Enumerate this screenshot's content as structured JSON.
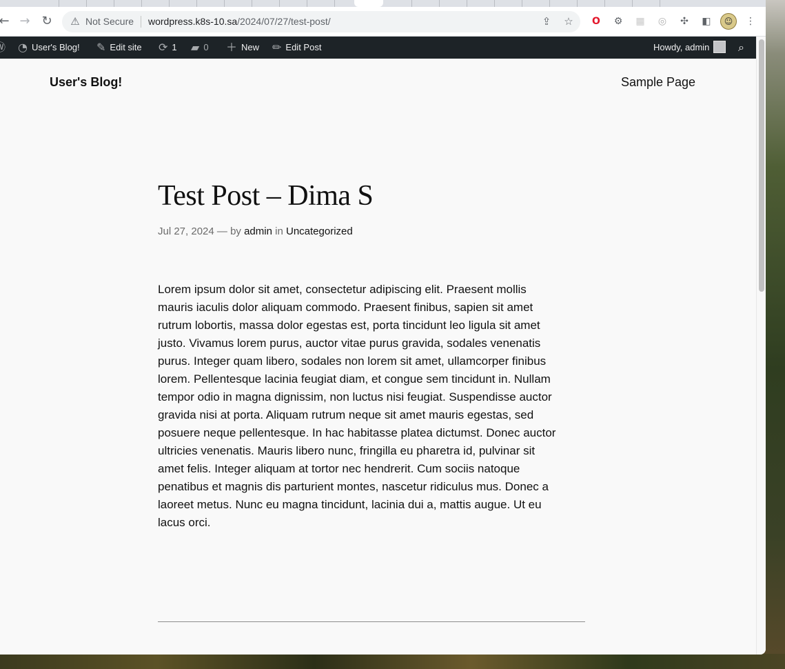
{
  "browser": {
    "security_label": "Not Secure",
    "url_host": "wordpress.k8s-10.sa",
    "url_path": "/2024/07/27/test-post/",
    "icons": {
      "back": "back-arrow-icon",
      "forward": "forward-arrow-icon",
      "reload": "reload-icon",
      "warning": "warning-icon",
      "share": "share-icon",
      "bookmark": "star-icon",
      "extensions": "puzzle-icon",
      "sidepanel": "side-panel-icon",
      "menu": "kebab-menu-icon"
    }
  },
  "adminbar": {
    "site_name": "User's Blog!",
    "edit_site": "Edit site",
    "updates_count": "1",
    "comments_count": "0",
    "new_label": "New",
    "edit_post": "Edit Post",
    "howdy": "Howdy, admin"
  },
  "site": {
    "title": "User's Blog!",
    "nav": [
      "Sample Page"
    ]
  },
  "post": {
    "title": "Test Post – Dima S",
    "date": "Jul 27, 2024",
    "by_sep": "— by",
    "author": "admin",
    "in_label": "in",
    "category": "Uncategorized",
    "body_lines": [
      "Lorem ipsum dolor sit amet, consectetur adipiscing elit. Praesent mollis",
      "mauris iaculis dolor aliquam commodo. Praesent finibus, sapien sit amet",
      "rutrum lobortis, massa dolor egestas est, porta tincidunt leo ligula sit amet",
      "justo. Vivamus lorem purus, auctor vitae purus gravida, sodales venenatis",
      "purus. Integer quam libero, sodales non lorem sit amet, ullamcorper finibus",
      "lorem. Pellentesque lacinia feugiat diam, et congue sem tincidunt in. Nullam",
      "tempor odio in magna dignissim, non luctus nisi feugiat. Suspendisse auctor",
      "gravida nisi at porta. Aliquam rutrum neque sit amet mauris egestas, sed",
      "posuere neque pellentesque. In hac habitasse platea dictumst. Donec auctor",
      "ultricies venenatis. Mauris libero nunc, fringilla eu pharetra id, pulvinar sit",
      "amet felis. Integer aliquam at tortor nec hendrerit. Cum sociis natoque",
      "penatibus et magnis dis parturient montes, nascetur ridiculus mus. Donec a",
      "laoreet metus. Nunc eu magna tincidunt, lacinia dui a, mattis augue. Ut eu",
      "lacus orci."
    ]
  },
  "colors": {
    "adminbar_bg": "#1d2327",
    "page_bg": "#f9f9f9",
    "text": "#111111"
  }
}
